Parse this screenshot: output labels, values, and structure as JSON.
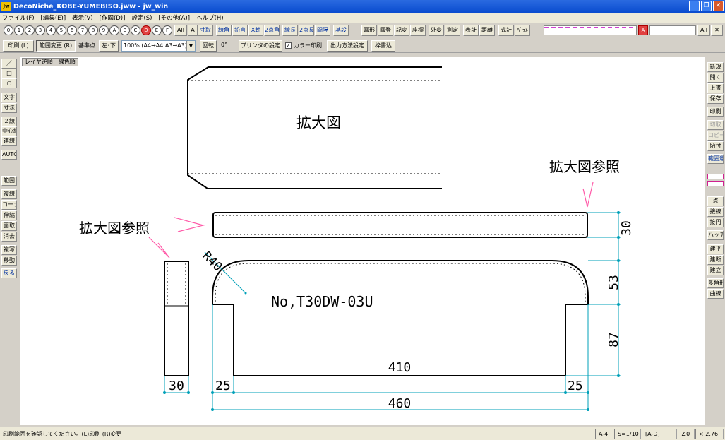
{
  "window": {
    "title": "DecoNiche_KOBE-YUMEBISO.jww - jw_win",
    "app_icon": "Jw",
    "controls": [
      "_",
      "❐",
      "✕"
    ]
  },
  "menubar": [
    "ファイル(F)",
    "[編集(E)]",
    "表示(V)",
    "[作図(D)]",
    "設定(S)",
    "[その他(A)]",
    "ヘルプ(H)"
  ],
  "toolbar1": {
    "layers": [
      "0",
      "1",
      "2",
      "3",
      "4",
      "5",
      "6",
      "7",
      "8",
      "9",
      "A",
      "B",
      "C",
      "D",
      "E",
      "F"
    ],
    "all_label": "All",
    "a_label": "A",
    "commands": [
      "寸取",
      "線角",
      "鉛直",
      "X軸",
      "2点角",
      "線長",
      "2点長",
      "間隔",
      "基設",
      "図形",
      "図登",
      "記変",
      "座標",
      "外変",
      "測定",
      "表計",
      "距離",
      "式計",
      "ﾊﾟﾗﾒ"
    ],
    "layer_group_all": "All",
    "layer_group_a": "A",
    "layer_group_x": "✕"
  },
  "toolbar2": {
    "print_btn": "印刷 (L)",
    "range_btn": "範囲変更 (R)",
    "base_label": "基準点",
    "base_btn": "左･下",
    "scale_select": "100% (A4→A4,A3→A3)",
    "rotate_btn": "回転",
    "rotate_value": "0°",
    "printer_btn": "プリンタの設定",
    "color_print_label": "カラー印刷",
    "color_print_checked": "✓",
    "output_btn": "出力方法設定",
    "frame_btn": "枠書込"
  },
  "left_tools": [
    "／",
    "□",
    "○",
    "文字",
    "寸法",
    "２線",
    "中心線",
    "連線",
    "AUTO",
    "範囲",
    "複線",
    "コーナー",
    "伸縮",
    "面取",
    "消去",
    "複写",
    "移動",
    "戻る"
  ],
  "right_tools": [
    "新規",
    "開く",
    "上書",
    "保存",
    "印刷",
    "切取",
    "コピー",
    "貼付",
    "範囲選",
    "点",
    "接線",
    "接円",
    "ハッチ",
    "建平",
    "建断",
    "建立",
    "多角形",
    "曲線"
  ],
  "canvas": {
    "layer_label": "レイヤ逆順　線色順",
    "enlarged_label": "拡大図",
    "ref_label_right": "拡大図参照",
    "ref_label_left": "拡大図参照",
    "part_number": "No,T30DW-03U",
    "radius_label": "R40",
    "dims": {
      "thickness_right": "30",
      "top_height": "53",
      "leg_height": "87",
      "inner_width": "410",
      "leg_left": "25",
      "leg_right": "25",
      "overall_width": "460",
      "side_thickness": "30"
    }
  },
  "statusbar": {
    "message": "印刷範囲を確認してください。(L)印刷 (R)変更",
    "paper": "A-4",
    "scale": "S=1/10",
    "layer": "[A-D]",
    "angle": "∠0",
    "zoom": "× 2.76"
  },
  "colors": {
    "pink": "#ff5aa8",
    "cyan": "#00a0b8",
    "title_blue": "#0a4ccf"
  }
}
